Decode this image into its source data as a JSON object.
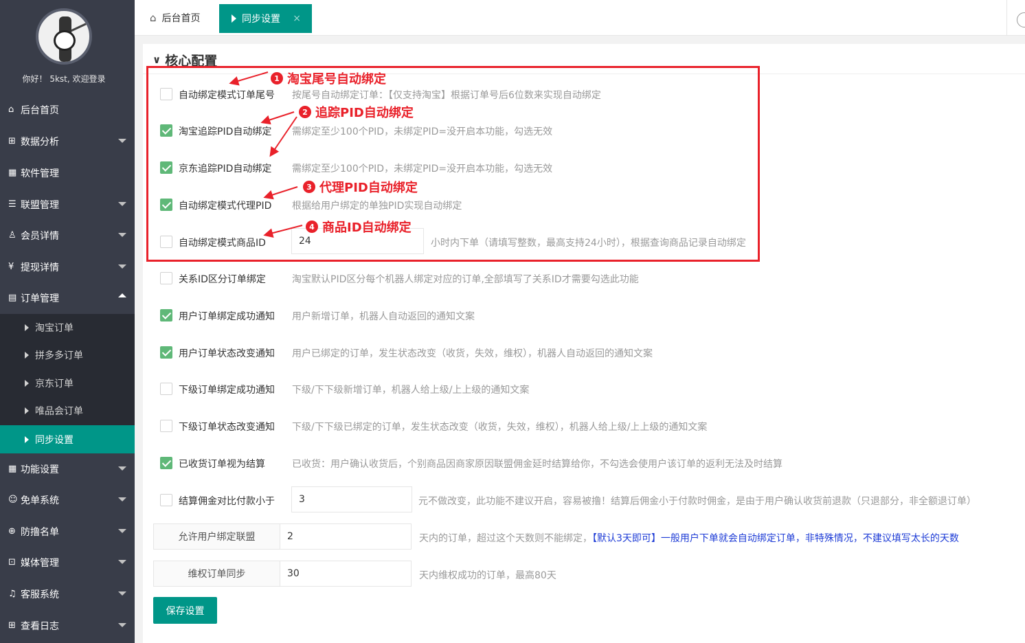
{
  "sidebar": {
    "welcome": "你好！ 5kst, 欢迎登录",
    "items": [
      {
        "icon": "⌂",
        "label": "后台首页"
      },
      {
        "icon": "⊞",
        "label": "数据分析"
      },
      {
        "icon": "▦",
        "label": "软件管理"
      },
      {
        "icon": "☰",
        "label": "联盟管理"
      },
      {
        "icon": "♙",
        "label": "会员详情"
      },
      {
        "icon": "¥",
        "label": "提现详情"
      },
      {
        "icon": "▤",
        "label": "订单管理"
      },
      {
        "icon": "▦",
        "label": "功能设置"
      },
      {
        "icon": "☺",
        "label": "免单系统"
      },
      {
        "icon": "⊕",
        "label": "防撸名单"
      },
      {
        "icon": "⊡",
        "label": "媒体管理"
      },
      {
        "icon": "♫",
        "label": "客服系统"
      },
      {
        "icon": "⊞",
        "label": "查看日志"
      }
    ],
    "order_sub": [
      "淘宝订单",
      "拼多多订单",
      "京东订单",
      "唯品会订单",
      "同步设置"
    ]
  },
  "tabs": {
    "home": "后台首页",
    "active": "同步设置",
    "close": "×"
  },
  "panel": {
    "title": "核心配置",
    "rows": [
      {
        "label": "自动绑定模式订单尾号",
        "desc": "按尾号自动绑定订单：【仅支持淘宝】根据订单号后6位数来实现自动绑定"
      },
      {
        "label": "淘宝追踪PID自动绑定",
        "desc": "需绑定至少100个PID，未绑定PID=没开启本功能，勾选无效"
      },
      {
        "label": "京东追踪PID自动绑定",
        "desc": "需绑定至少100个PID，未绑定PID=没开启本功能，勾选无效"
      },
      {
        "label": "自动绑定模式代理PID",
        "desc": "根据给用户绑定的单独PID实现自动绑定"
      },
      {
        "label": "自动绑定模式商品ID",
        "value": "24",
        "desc": "小时内下单（请填写整数，最高支持24小时），根据查询商品记录自动绑定"
      },
      {
        "label": "关系ID区分订单绑定",
        "desc": "淘宝默认PID区分每个机器人绑定对应的订单,全部填写了关系ID才需要勾选此功能"
      },
      {
        "label": "用户订单绑定成功通知",
        "desc": "用户新增订单，机器人自动返回的通知文案"
      },
      {
        "label": "用户订单状态改变通知",
        "desc": "用户已绑定的订单，发生状态改变（收货，失效，维权），机器人自动返回的通知文案"
      },
      {
        "label": "下级订单绑定成功通知",
        "desc": "下级/下下级新增订单，机器人给上级/上上级的通知文案"
      },
      {
        "label": "下级订单状态改变通知",
        "desc": "下级/下下级已绑定的订单，发生状态改变（收货，失效，维权），机器人给上级/上上级的通知文案"
      },
      {
        "label": "已收货订单视为结算",
        "desc": "已收货：用户确认收货后，个别商品因商家原因联盟佣金延时结算给你，不勾选会使用户该订单的返利无法及时结算"
      },
      {
        "label": "结算佣金对比付款小于",
        "value": "3",
        "desc": "元不做改变，此功能不建议开启，容易被撸！结算后佣金小于付款时佣金，是由于用户确认收货前退款（只退部分，非全额退订单）"
      },
      {
        "label": "允许用户绑定联盟",
        "value": "2",
        "desc": "天内的订单，超过这个天数则不能绑定，",
        "desc_blue": "【默认3天即可】一般用户下单就会自动绑定订单，非特殊情况，不建议填写太长的天数"
      },
      {
        "label": "维权订单同步",
        "value": "30",
        "desc": "天内维权成功的订单，最高80天"
      }
    ],
    "checked": [
      false,
      true,
      true,
      true,
      false,
      false,
      true,
      true,
      false,
      false,
      true,
      false
    ],
    "save": "保存设置"
  },
  "annotations": [
    {
      "num": "1",
      "text": "淘宝尾号自动绑定"
    },
    {
      "num": "2",
      "text": "追踪PID自动绑定"
    },
    {
      "num": "3",
      "text": "代理PID自动绑定"
    },
    {
      "num": "4",
      "text": "商品ID自动绑定"
    }
  ],
  "colors": {
    "accent": "#009688",
    "check": "#5fb878",
    "annotation": "#e9212a",
    "sidebar": "#393d49"
  }
}
